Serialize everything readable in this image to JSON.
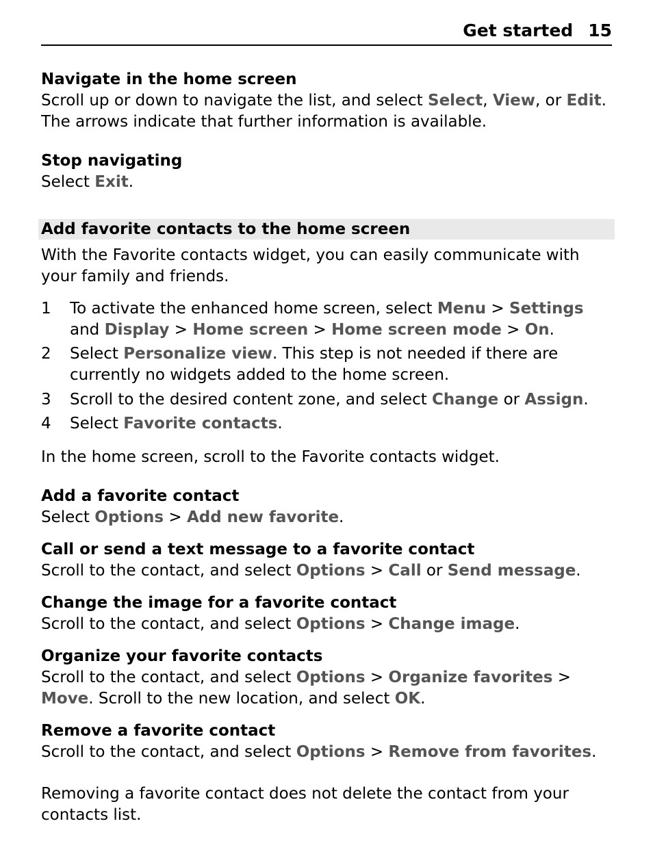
{
  "header": {
    "section": "Get started",
    "page": "15"
  },
  "nav_home": {
    "title": "Navigate in the home screen",
    "p_a": "Scroll up or down to navigate the list, and select ",
    "kw_select": "Select",
    "p_b": ", ",
    "kw_view": "View",
    "p_c": ", or ",
    "kw_edit": "Edit",
    "p_d": ". The arrows indicate that further information is available."
  },
  "stop_nav": {
    "title": "Stop navigating",
    "p_a": "Select ",
    "kw_exit": "Exit",
    "p_b": "."
  },
  "fav_bar": "Add favorite contacts to the home screen",
  "fav_intro": "With the Favorite contacts widget, you can easily communicate with your family and friends.",
  "step1": {
    "a": "To activate the enhanced home screen, select ",
    "menu": "Menu",
    "gt1": "  > ",
    "settings": "Settings",
    "and": " and ",
    "display": "Display",
    "gt2": "  > ",
    "home_screen": "Home screen",
    "gt3": "  > ",
    "home_screen_mode": "Home screen mode",
    "gt4": "  > ",
    "on": "On",
    "dot": "."
  },
  "step2": {
    "a": "Select ",
    "personalize": "Personalize view",
    "b": ". This step is not needed if there are currently no widgets added to the home screen."
  },
  "step3": {
    "a": "Scroll to the desired content zone, and select ",
    "change": "Change",
    "or": " or ",
    "assign": "Assign",
    "dot": "."
  },
  "step4": {
    "a": "Select ",
    "fav": "Favorite contacts",
    "dot": "."
  },
  "after_steps": "In the home screen, scroll to the Favorite contacts widget.",
  "add_fav": {
    "title": "Add a favorite contact",
    "a": "Select ",
    "options": "Options",
    "gt": "  > ",
    "add_new": "Add new favorite",
    "dot": "."
  },
  "call_send": {
    "title": "Call or send a text message to a favorite contact",
    "a": "Scroll to the contact, and select ",
    "options": "Options",
    "gt": "  > ",
    "call": "Call",
    "or": " or ",
    "send": "Send message",
    "dot": "."
  },
  "change_img": {
    "title": "Change the image for a favorite contact",
    "a": "Scroll to the contact, and select ",
    "options": "Options",
    "gt": "  > ",
    "change_image": "Change image",
    "dot": "."
  },
  "organize": {
    "title": "Organize your favorite contacts",
    "a": "Scroll to the contact, and select ",
    "options": "Options",
    "gt1": "  > ",
    "org_fav": "Organize favorites",
    "gt2": "  > ",
    "move": "Move",
    "b": ". Scroll to the new location, and select ",
    "ok": "OK",
    "dot": "."
  },
  "remove": {
    "title": "Remove a favorite contact",
    "a": "Scroll to the contact, and select ",
    "options": "Options",
    "gt": "  > ",
    "remove_fav": "Remove from favorites",
    "dot": "."
  },
  "remove_note": "Removing a favorite contact does not delete the contact from your contacts list."
}
